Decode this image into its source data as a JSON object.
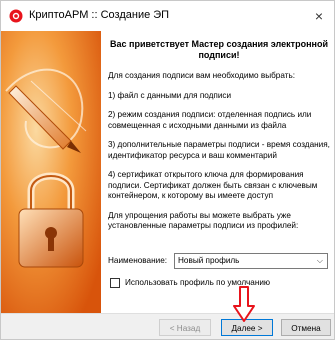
{
  "window": {
    "title": "КриптоАРМ :: Создание ЭП",
    "close_glyph": "×"
  },
  "wizard": {
    "heading": "Вас приветствует Мастер создания электронной подписи!",
    "intro": "Для создания подписи вам необходимо выбрать:",
    "items": [
      "1) файл с данными для подписи",
      "2) режим создания подписи: отделенная подпись или совмещенная с исходными данными из файла",
      "3) дополнительные параметры подписи - время создания, идентификатор ресурса и ваш комментарий",
      "4) сертификат открытого ключа для формирования подписи. Сертификат должен быть связан с ключевым контейнером, к которому вы имеете доступ"
    ],
    "profile_hint": "Для упрощения работы вы можете выбрать уже установленные параметры подписи из профилей:"
  },
  "profile": {
    "label": "Наименование:",
    "selected": "Новый профиль",
    "arrow_glyph": "⌵"
  },
  "default_profile": {
    "label": "Использовать профиль по умолчанию",
    "checked": false
  },
  "buttons": {
    "back": "< Назад",
    "next": "Далее >",
    "cancel": "Отмена"
  },
  "colors": {
    "arrow_red": "#e8141c",
    "orange_dark": "#d95a0a",
    "orange_light": "#f6a24a",
    "primary_border": "#0078d7"
  },
  "icons": {
    "app": "cryptoarm-icon",
    "side_art": "pen-and-padlock-icon",
    "pointer": "red-arrow-icon"
  }
}
